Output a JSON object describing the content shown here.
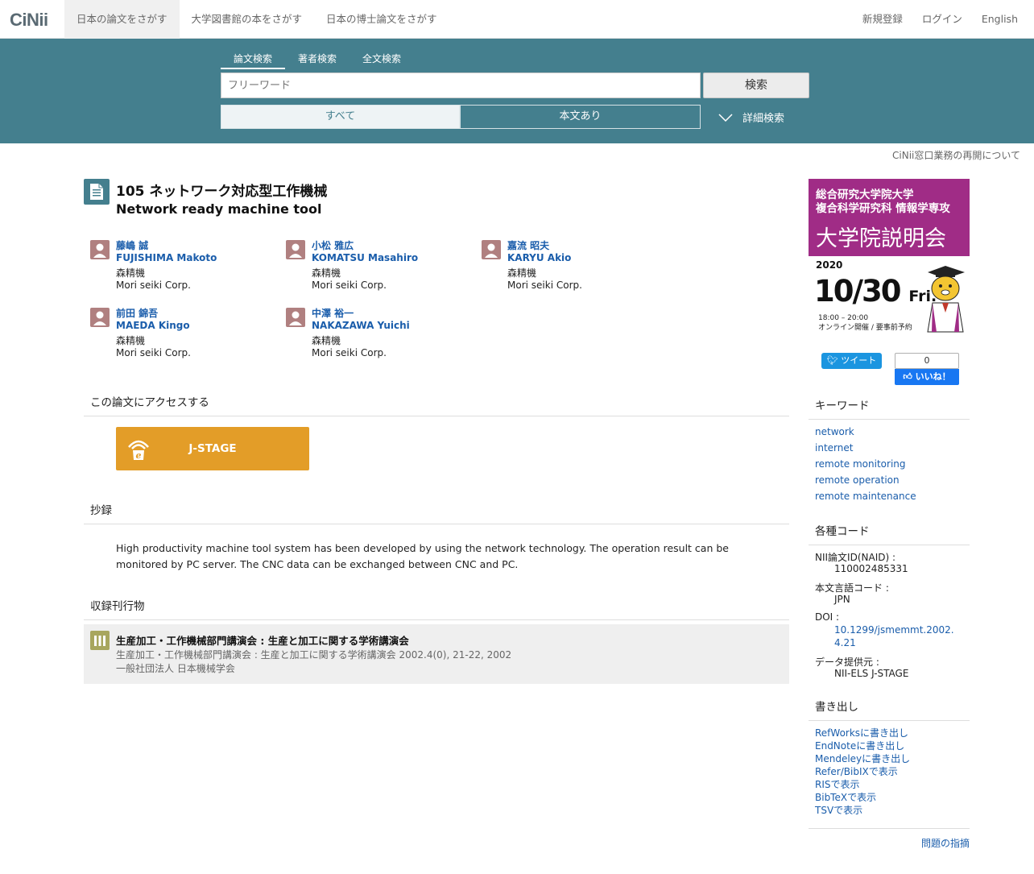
{
  "nav": {
    "logo": "CiNii",
    "tabs": [
      "日本の論文をさがす",
      "大学図書館の本をさがす",
      "日本の博士論文をさがす"
    ],
    "right": [
      "新規登録",
      "ログイン",
      "English"
    ]
  },
  "search": {
    "tabs": [
      "論文検索",
      "著者検索",
      "全文検索"
    ],
    "placeholder": "フリーワード",
    "button": "検索",
    "filter_all": "すべて",
    "filter_body": "本文あり",
    "advanced": "詳細検索"
  },
  "notice": "CiNii窓口業務の再開について",
  "article": {
    "title_ja": "105 ネットワーク対応型工作機械",
    "title_en": "Network ready machine tool",
    "authors": [
      {
        "ja": "藤嶋 誠",
        "en": "FUJISHIMA Makoto",
        "aff_ja": "森精機",
        "aff_en": "Mori seiki Corp."
      },
      {
        "ja": "小松 雅広",
        "en": "KOMATSU Masahiro",
        "aff_ja": "森精機",
        "aff_en": "Mori seiki Corp."
      },
      {
        "ja": "嘉流 昭夫",
        "en": "KARYU Akio",
        "aff_ja": "森精機",
        "aff_en": "Mori seiki Corp."
      },
      {
        "ja": "前田 錦吾",
        "en": "MAEDA Kingo",
        "aff_ja": "森精機",
        "aff_en": "Mori seiki Corp."
      },
      {
        "ja": "中澤 裕一",
        "en": "NAKAZAWA Yuichi",
        "aff_ja": "森精機",
        "aff_en": "Mori seiki Corp."
      }
    ],
    "access_heading": "この論文にアクセスする",
    "jstage_label": "J-STAGE",
    "abstract_heading": "抄録",
    "abstract": "High productivity machine tool system has been developed by using the network technology. The operation result can be monitored by PC server. The CNC data can be exchanged between CNC and PC.",
    "journal_heading": "収録刊行物",
    "journal_title": "生産加工・工作機械部門講演会 : 生産と加工に関する学術講演会",
    "journal_cite": "生産加工・工作機械部門講演会 : 生産と加工に関する学術講演会 2002.4(0), 21-22, 2002",
    "journal_publisher": "一般社団法人 日本機械学会"
  },
  "ad": {
    "line1": "総合研究大学院大学",
    "line2": "複合科学研究科 情報学専攻",
    "line3": "大学院説明会",
    "year": "2020",
    "date": "10/30",
    "day": "Fri.",
    "time": "18:00 – 20:00",
    "mode": "オンライン開催 / 要事前予約"
  },
  "social": {
    "tweet": "ツイート",
    "fb_count": "0",
    "fb_like": "いいね！"
  },
  "keywords": {
    "heading": "キーワード",
    "items": [
      "network",
      "internet",
      "remote monitoring",
      "remote operation",
      "remote maintenance"
    ]
  },
  "codes": {
    "heading": "各種コード",
    "naid_label": "NII論文ID(NAID) :",
    "naid": "110002485331",
    "lang_label": "本文言語コード :",
    "lang": "JPN",
    "doi_label": "DOI :",
    "doi": "10.1299/jsmemmt.2002.4.21",
    "provider_label": "データ提供元 :",
    "provider": "NII-ELS  J-STAGE"
  },
  "export": {
    "heading": "書き出し",
    "items": [
      "RefWorksに書き出し",
      "EndNoteに書き出し",
      "Mendeleyに書き出し",
      "Refer/BibIXで表示",
      "RISで表示",
      "BibTeXで表示",
      "TSVで表示"
    ]
  },
  "report": "問題の指摘",
  "colors": {
    "band": "#447f8e",
    "link": "#1a5dab",
    "jstage": "#e39d28",
    "ad": "#a02c86"
  }
}
